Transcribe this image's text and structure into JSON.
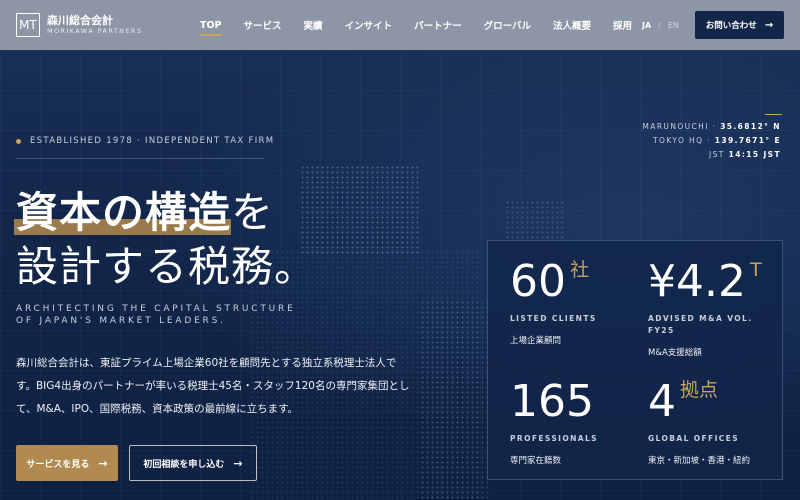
{
  "header": {
    "logo_mark": "MT",
    "logo_ja": "森川総合会計",
    "logo_en": "MORIKAWA PARTNERS",
    "nav": [
      {
        "label": "TOP",
        "active": true
      },
      {
        "label": "サービス"
      },
      {
        "label": "実績"
      },
      {
        "label": "インサイト"
      },
      {
        "label": "パートナー"
      },
      {
        "label": "グローバル"
      },
      {
        "label": "法人概要"
      },
      {
        "label": "採用"
      }
    ],
    "lang_ja": "JA",
    "lang_sep": "/",
    "lang_en": "EN",
    "contact_label": "お問い合わせ",
    "arrow": "→"
  },
  "hero": {
    "established": "ESTABLISHED 1978 · INDEPENDENT TAX FIRM",
    "headline_mark": "資本の構造",
    "headline_rest": "を",
    "headline_line2": "設計する税務。",
    "sub_en_line1": "ARCHITECTING THE CAPITAL STRUCTURE",
    "sub_en_line2": "OF JAPAN'S MARKET LEADERS.",
    "description": "森川総合会計は、東証プライム上場企業60社を顧問先とする独立系税理士法人です。BIG4出身のパートナーが率いる税理士45名・スタッフ120名の専門家集団として、M&A、IPO、国際税務、資本政策の最前線に立ちます。",
    "primary_button": "サービスを見る",
    "secondary_button": "初回相談を申し込む",
    "arrow": "→"
  },
  "coords": {
    "line1_label": "MARUNOUCHI ·",
    "line1_value": "35.6812° N",
    "line2_label": "TOKYO HQ ·",
    "line2_value": "139.7671° E",
    "line3_label": "JST",
    "line3_value": "14:15 JST"
  },
  "stats": [
    {
      "num": "60",
      "suffix": "社",
      "label_en": "LISTED CLIENTS",
      "label_ja": "上場企業顧問"
    },
    {
      "num": "¥4.2",
      "suffix": "T",
      "label_en": "ADVISED M&A VOL. FY25",
      "label_ja": "M&A支援総額"
    },
    {
      "num": "165",
      "suffix": "",
      "label_en": "PROFESSIONALS",
      "label_ja": "専門家在籍数"
    },
    {
      "num": "4",
      "suffix": "拠点",
      "label_en": "GLOBAL OFFICES",
      "label_ja": "東京・新加坡・香港・紐約"
    }
  ],
  "colors": {
    "accent_gold": "#c8a25f",
    "navy": "#12264a",
    "header_gray": "#8d96a6"
  }
}
